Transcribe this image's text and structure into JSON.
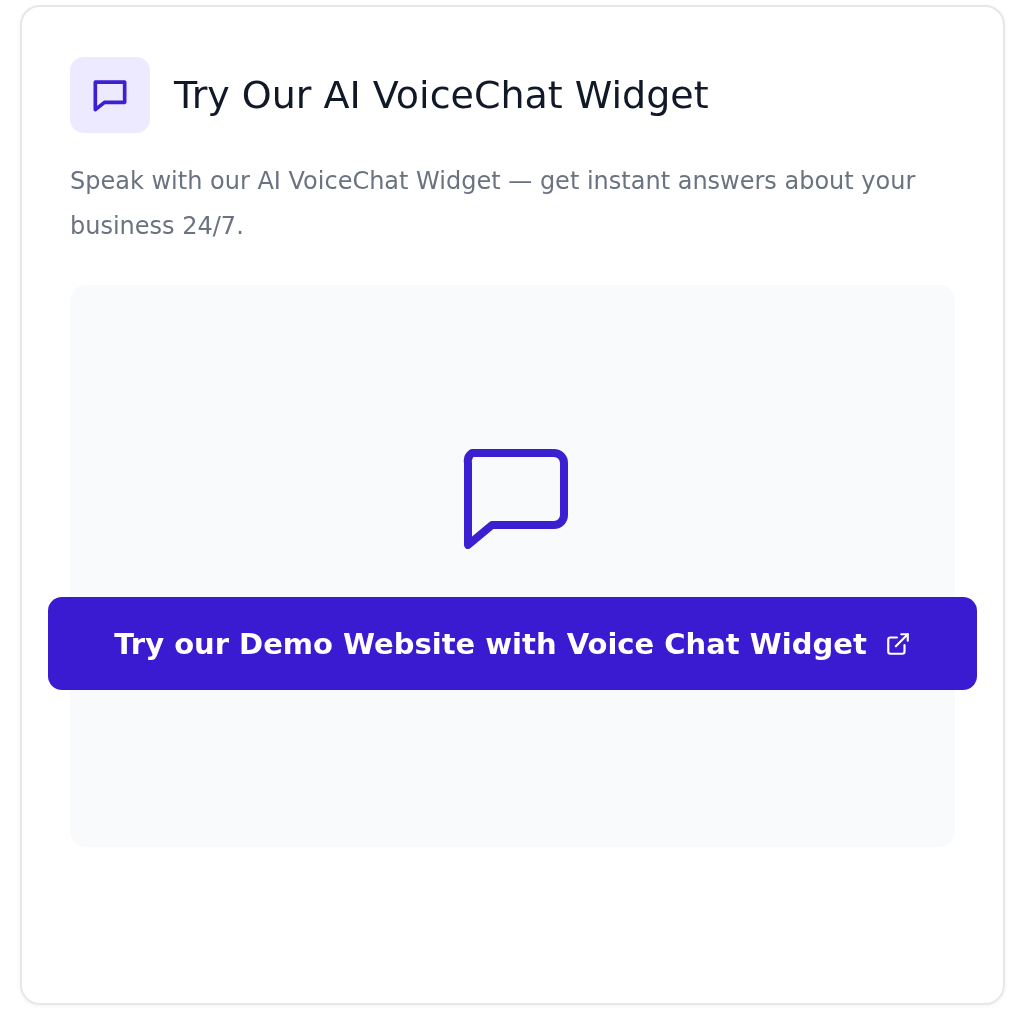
{
  "card": {
    "title": "Try Our AI VoiceChat Widget",
    "description": "Speak with our AI VoiceChat Widget — get instant answers about your business 24/7."
  },
  "demo": {
    "button": {
      "label": "Try our Demo Website with Voice Chat Widget"
    }
  }
}
